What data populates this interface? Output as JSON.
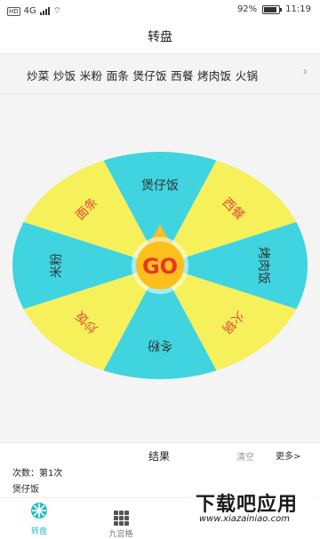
{
  "status_bar": {
    "battery": "92%",
    "time": "11:19",
    "hd": "HD",
    "net": "4G"
  },
  "header": {
    "title": "转盘"
  },
  "options": {
    "text": "炒菜 炒饭 米粉 面条 煲仔饭 西餐 烤肉饭 火锅",
    "chevron": "›"
  },
  "wheel": {
    "segments": [
      "煲仔饭",
      "西餐",
      "烤肉饭",
      "火锅",
      "冬粉",
      "炒饭",
      "米粉",
      "面条"
    ],
    "colors": {
      "cyan": "#3fd4df",
      "yellow": "#f6f05b",
      "center": "#fdbf1c",
      "text": "#e14b3b",
      "go_text": "#e8362b"
    },
    "go_label": "GO"
  },
  "results": {
    "title": "结果",
    "clear": "清空",
    "more": "更多>",
    "count": "次数：第1次",
    "latest": "煲仔饭"
  },
  "nav": {
    "wheel": "转盘",
    "grid": "九宫格"
  },
  "watermark": {
    "text": "下载吧应用",
    "url": "www.xiazainiao.com"
  }
}
